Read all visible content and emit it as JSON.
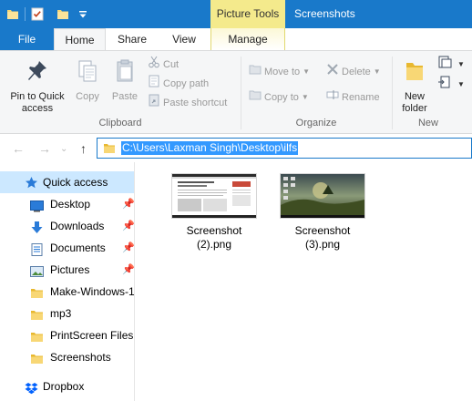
{
  "titlebar": {
    "contextual_tab_title": "Picture Tools",
    "window_title": "Screenshots",
    "qat_icons": [
      "folder-icon",
      "properties-icon",
      "new-folder-icon",
      "customize-dropdown-icon"
    ],
    "accent": "#1979ca",
    "contextual_color": "#f4ea8c"
  },
  "tabs": {
    "file": "File",
    "home": "Home",
    "share": "Share",
    "view": "View",
    "manage": "Manage",
    "active": "Home"
  },
  "ribbon": {
    "clipboard": {
      "label": "Clipboard",
      "pin_to_quick_access": [
        "Pin to Quick",
        "access"
      ],
      "copy": "Copy",
      "paste": "Paste",
      "cut": "Cut",
      "copy_path": "Copy path",
      "paste_shortcut": "Paste shortcut"
    },
    "organize": {
      "label": "Organize",
      "move_to": "Move to",
      "copy_to": "Copy to",
      "delete": "Delete",
      "rename": "Rename"
    },
    "new": {
      "label": "New",
      "new_folder": [
        "New",
        "folder"
      ]
    }
  },
  "addressbar": {
    "path": "C:\\Users\\Laxman Singh\\Desktop\\ilfs"
  },
  "navpane": {
    "quick_access": "Quick access",
    "items": [
      {
        "label": "Desktop",
        "icon": "desktop-icon",
        "pinned": true
      },
      {
        "label": "Downloads",
        "icon": "download-arrow-icon",
        "pinned": true
      },
      {
        "label": "Documents",
        "icon": "documents-icon",
        "pinned": true
      },
      {
        "label": "Pictures",
        "icon": "pictures-icon",
        "pinned": true
      },
      {
        "label": "Make-Windows-1",
        "icon": "folder-icon",
        "pinned": false
      },
      {
        "label": "mp3",
        "icon": "folder-icon",
        "pinned": false
      },
      {
        "label": "PrintScreen Files",
        "icon": "folder-icon",
        "pinned": false
      },
      {
        "label": "Screenshots",
        "icon": "folder-icon",
        "pinned": false
      }
    ],
    "dropbox": "Dropbox"
  },
  "files": [
    {
      "name_line1": "Screenshot",
      "name_line2": "(2).png",
      "thumb": "webpage"
    },
    {
      "name_line1": "Screenshot",
      "name_line2": "(3).png",
      "thumb": "desktop-landscape"
    }
  ]
}
